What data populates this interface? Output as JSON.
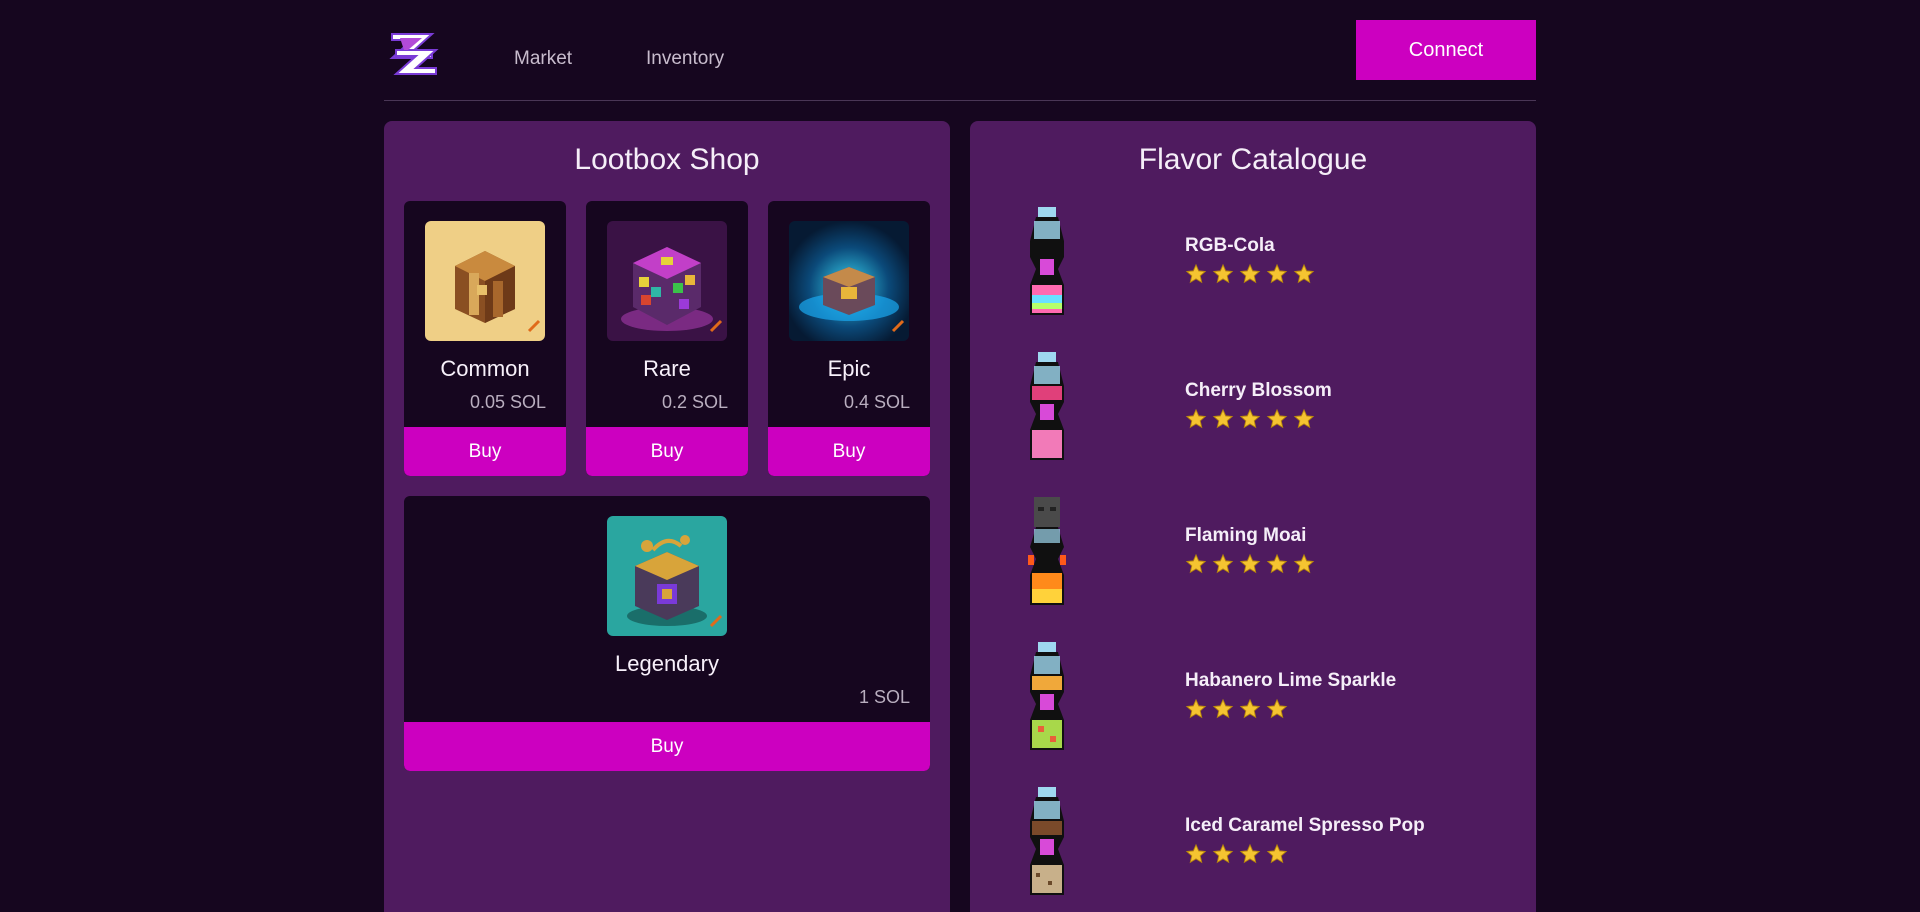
{
  "nav": {
    "market": "Market",
    "inventory": "Inventory",
    "connect": "Connect"
  },
  "shop": {
    "title": "Lootbox Shop",
    "boxes": [
      {
        "name": "Common",
        "price": "0.05 SOL",
        "buy": "Buy"
      },
      {
        "name": "Rare",
        "price": "0.2 SOL",
        "buy": "Buy"
      },
      {
        "name": "Epic",
        "price": "0.4 SOL",
        "buy": "Buy"
      },
      {
        "name": "Legendary",
        "price": "1 SOL",
        "buy": "Buy"
      }
    ]
  },
  "catalogue": {
    "title": "Flavor Catalogue",
    "flavors": [
      {
        "name": "RGB-Cola",
        "stars": 5
      },
      {
        "name": "Cherry Blossom",
        "stars": 5
      },
      {
        "name": "Flaming Moai",
        "stars": 5
      },
      {
        "name": "Habanero Lime Sparkle",
        "stars": 4
      },
      {
        "name": "Iced Caramel Spresso Pop",
        "stars": 4
      }
    ]
  },
  "colors": {
    "background": "#16061f",
    "panel": "#4f1b5f",
    "accent": "#cc00c0",
    "star": "#f5c431"
  }
}
